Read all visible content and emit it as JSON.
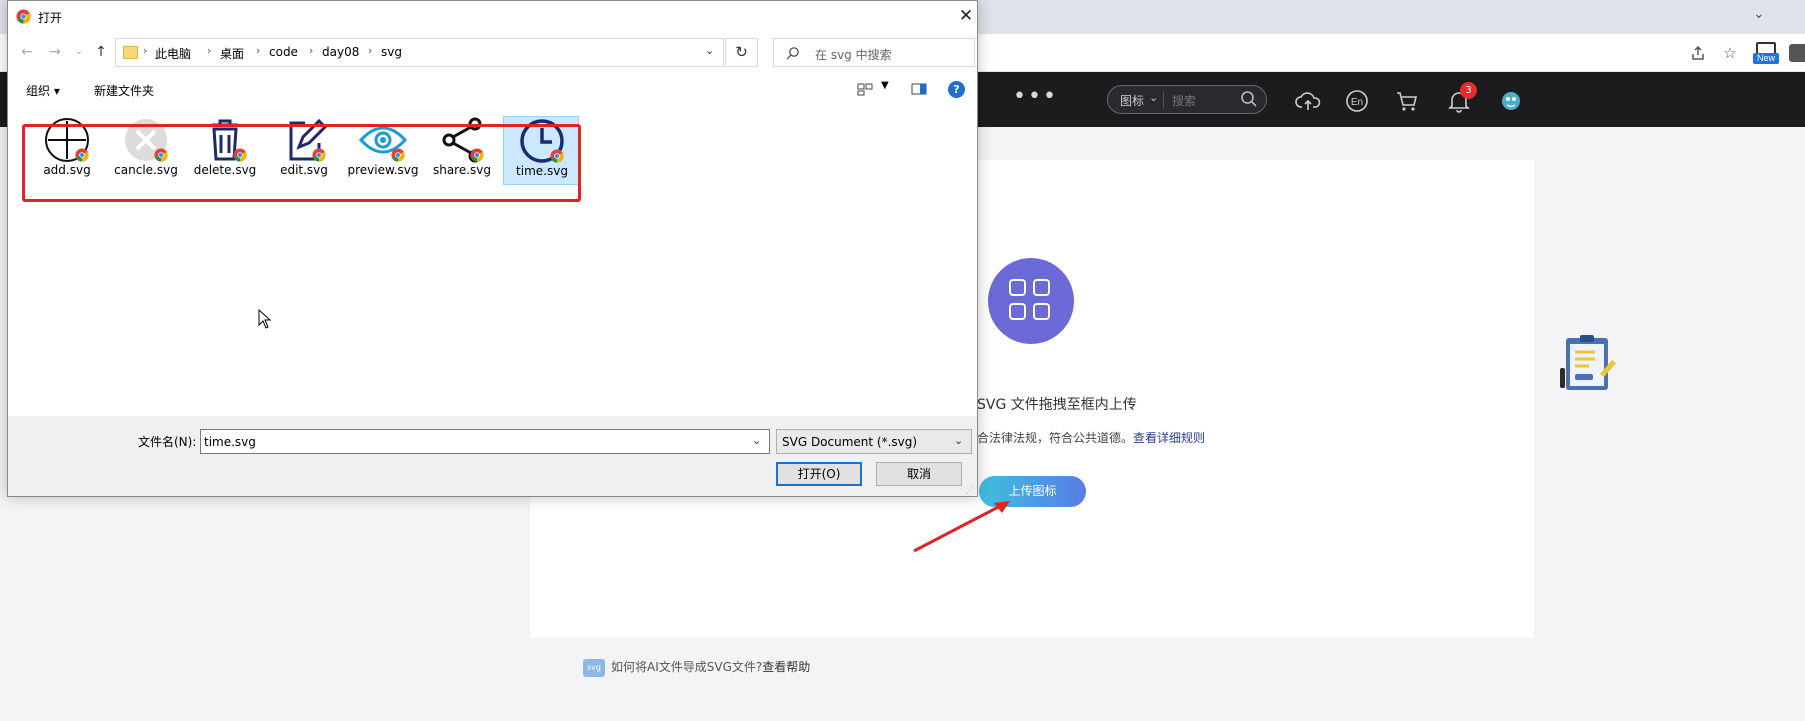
{
  "browser": {
    "new_badge_label": "New"
  },
  "site_header": {
    "more_label": "•••",
    "search_scope": "图标",
    "search_placeholder": "搜索",
    "notification_count": "3",
    "language_label": "En"
  },
  "upload_page": {
    "hint_title": "SVG 文件拖拽至框内上传",
    "hint_rule": "合法律法规，符合公共道德。",
    "rule_link": "查看详细规则",
    "upload_button": "上传图标",
    "help_question": "如何将AI文件导成SVG文件?",
    "help_link": "查看帮助",
    "help_icon_label": "svg",
    "upload_circle_color": "#6b6ad7",
    "button_gradient": [
      "#3ec0de",
      "#5a7be6"
    ]
  },
  "dialog": {
    "title": "打开",
    "close_glyph": "✕",
    "nav": {
      "back": "←",
      "forward": "→",
      "recent": "⌄",
      "up": "↑"
    },
    "breadcrumb": [
      "此电脑",
      "桌面",
      "code",
      "day08",
      "svg"
    ],
    "search_placeholder": "在 svg 中搜索",
    "commands": {
      "organize": "组织 ▾",
      "new_folder": "新建文件夹"
    },
    "help_glyph": "?",
    "files": [
      {
        "name": "add.svg",
        "icon": "add-circle-icon",
        "selected": false
      },
      {
        "name": "cancle.svg",
        "icon": "cancel-icon",
        "selected": false
      },
      {
        "name": "delete.svg",
        "icon": "trash-icon",
        "selected": false
      },
      {
        "name": "edit.svg",
        "icon": "edit-icon",
        "selected": false
      },
      {
        "name": "preview.svg",
        "icon": "eye-icon",
        "selected": false
      },
      {
        "name": "share.svg",
        "icon": "share-icon",
        "selected": false
      },
      {
        "name": "time.svg",
        "icon": "clock-icon",
        "selected": true
      }
    ],
    "filename_label": "文件名(N):",
    "filename_value": "time.svg",
    "filetype_value": "SVG Document (*.svg)",
    "open_button": "打开(O)",
    "cancel_button": "取消",
    "highlight_color": "#e22323"
  }
}
